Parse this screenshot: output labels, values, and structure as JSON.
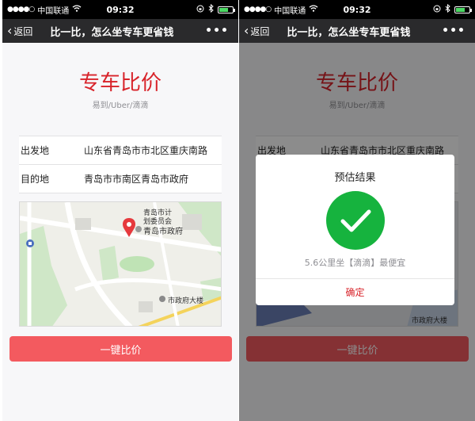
{
  "status_bar": {
    "signal_dots": "●●●●○",
    "carrier": "中国联通",
    "time": "09:32"
  },
  "nav": {
    "back_label": "返回",
    "title": "比一比，怎么坐专车更省钱",
    "more_label": "•••"
  },
  "page": {
    "title": "专车比价",
    "subtitle": "易到/Uber/滴滴",
    "form": {
      "origin_label": "出发地",
      "origin_value": "山东省青岛市市北区重庆南路",
      "destination_label": "目的地",
      "destination_value": "青岛市市南区青岛市政府"
    },
    "map": {
      "poi_main": "青岛市政府",
      "poi_planning_line1": "青岛市计",
      "poi_planning_line2": "划委员会",
      "poi_building": "市政府大楼",
      "poi_right_dialog_side": "市政府大楼"
    },
    "compare_button": "一键比价"
  },
  "dialog": {
    "title": "预估结果",
    "message": "5.6公里坐【滴滴】最便宜",
    "ok_button": "确定"
  },
  "colors": {
    "accent_red": "#d8232a",
    "button_red": "#f35a5f",
    "success_green": "#16b33e",
    "navbar_dark": "#2a2a2c"
  }
}
